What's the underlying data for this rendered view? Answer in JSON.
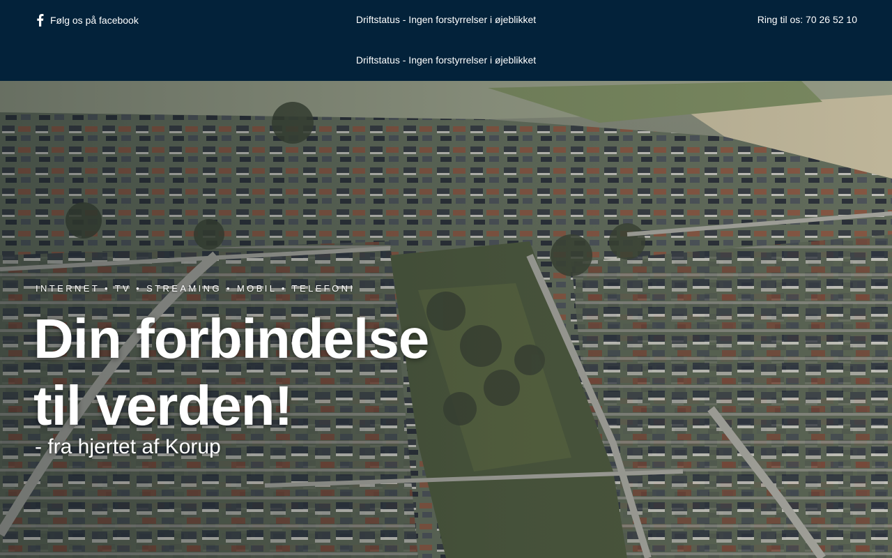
{
  "topbar": {
    "facebook_label": "Følg os på facebook",
    "status_text": "Driftstatus - Ingen forstyrrelser i øjeblikket",
    "phone_text": "Ring til os: 70 26 52 10",
    "status_text_secondary": "Driftstatus - Ingen forstyrrelser i øjeblikket",
    "background_color": "#03223a"
  },
  "hero": {
    "eyebrow": "INTERNET • TV • STREAMING • MOBIL • TELEFONI",
    "headline_line1": "Din forbindelse",
    "headline_line2": "til verden!",
    "subline": "- fra hjertet af Korup",
    "background_image": "aerial-town-photo"
  },
  "icons": {
    "facebook": "facebook-icon"
  }
}
